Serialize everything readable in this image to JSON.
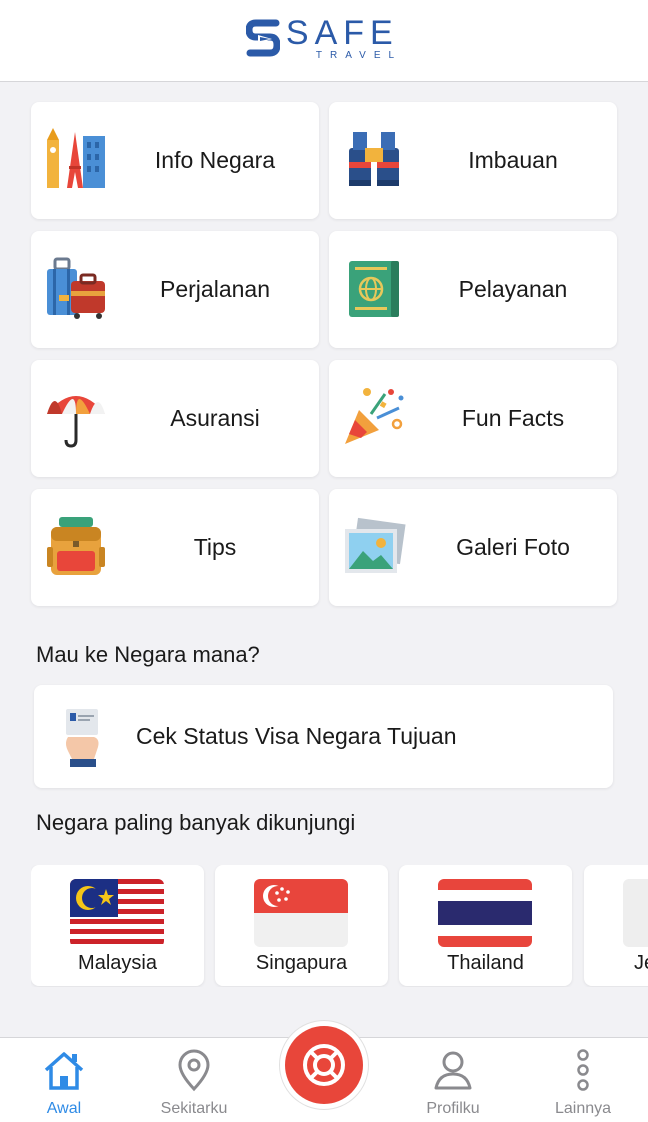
{
  "header": {
    "logo_word": "SAFE",
    "logo_sub": "TRAVEL"
  },
  "menu": [
    {
      "label": "Info Negara",
      "icon": "landmarks-icon"
    },
    {
      "label": "Imbauan",
      "icon": "binoculars-icon"
    },
    {
      "label": "Perjalanan",
      "icon": "luggage-icon"
    },
    {
      "label": "Pelayanan",
      "icon": "passport-icon"
    },
    {
      "label": "Asuransi",
      "icon": "umbrella-icon"
    },
    {
      "label": "Fun Facts",
      "icon": "party-popper-icon"
    },
    {
      "label": "Tips",
      "icon": "backpack-icon"
    },
    {
      "label": "Galeri Foto",
      "icon": "photo-gallery-icon"
    }
  ],
  "destination": {
    "title": "Mau ke Negara mana?",
    "visa_check_label": "Cek Status Visa Negara Tujuan"
  },
  "popular": {
    "title": "Negara paling banyak dikunjungi",
    "countries": [
      "Malaysia",
      "Singapura",
      "Thailand",
      "Je"
    ]
  },
  "tabbar": {
    "items": [
      {
        "label": "Awal",
        "icon": "home-icon",
        "active": true
      },
      {
        "label": "Sekitarku",
        "icon": "location-pin-icon",
        "active": false
      },
      {
        "label": "Profilku",
        "icon": "person-icon",
        "active": false
      },
      {
        "label": "Lainnya",
        "icon": "more-vertical-icon",
        "active": false
      }
    ],
    "sos_icon": "lifebuoy-icon"
  },
  "colors": {
    "brand": "#2b5aa8",
    "active_tab": "#2f8be6",
    "sos": "#e8463a",
    "background": "#f2f2f5"
  }
}
